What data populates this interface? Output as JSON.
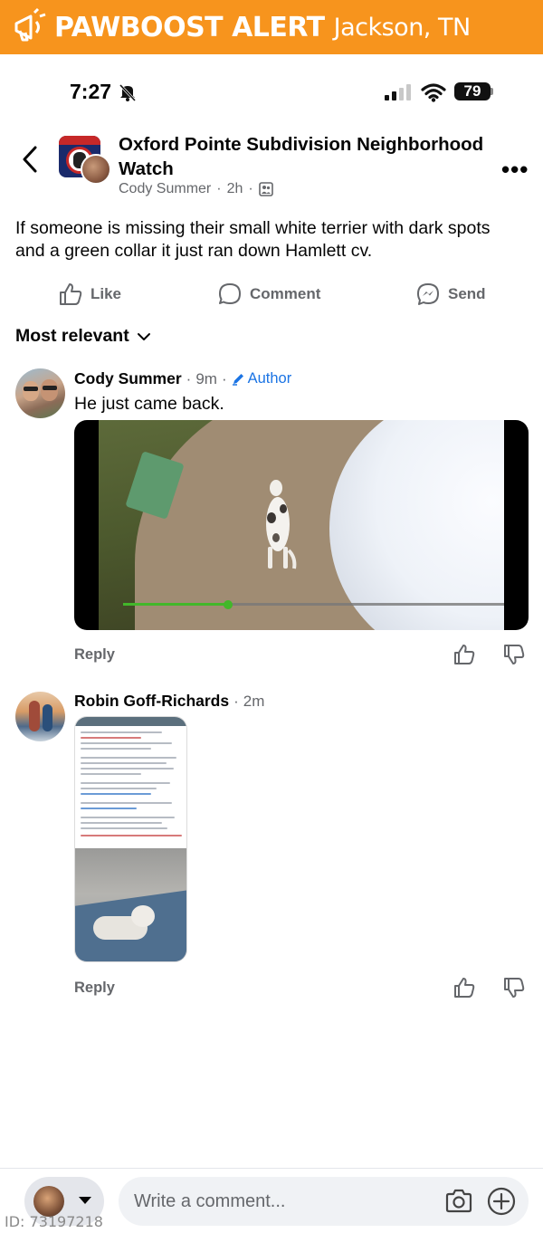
{
  "banner": {
    "brand": "PAWBOOST ALERT",
    "location": "Jackson, TN",
    "color": "#f7941d",
    "icon": "megaphone-icon"
  },
  "status_bar": {
    "time": "7:27",
    "battery": "79",
    "icons": [
      "bell-slash-icon",
      "signal-icon",
      "wifi-icon",
      "battery-icon"
    ]
  },
  "post": {
    "group_name": "Oxford Pointe Subdivision Neighborhood Watch",
    "author": "Cody Summer",
    "time": "2h",
    "audience_icon": "members-icon",
    "text": "If someone is missing their small white terrier with dark spots and a green collar it just ran down Hamlett cv.",
    "actions": {
      "like": "Like",
      "comment": "Comment",
      "send": "Send"
    }
  },
  "sort": {
    "label": "Most relevant"
  },
  "comments": [
    {
      "name": "Cody Summer",
      "time": "9m",
      "badge": "Author",
      "text": "He just came back.",
      "reply": "Reply",
      "media": "video",
      "video_progress": 0.26
    },
    {
      "name": "Robin Goff-Richards",
      "time": "2m",
      "reply": "Reply",
      "media": "screenshot"
    }
  ],
  "composer": {
    "placeholder": "Write a comment..."
  },
  "watermark": "ID: 73197218",
  "colors": {
    "accent_blue": "#1b74e4",
    "meta_grey": "#65676b",
    "progress_green": "#42b72a"
  }
}
